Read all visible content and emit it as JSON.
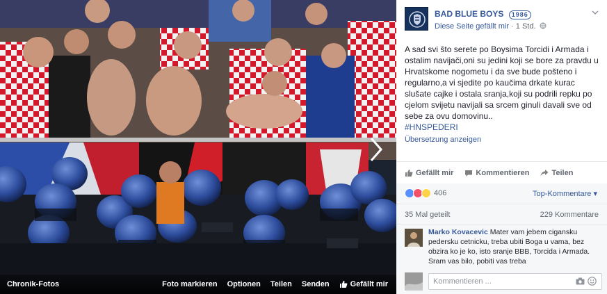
{
  "photo": {
    "album_label": "Chronik-Fotos",
    "actions": [
      "Foto markieren",
      "Optionen",
      "Teilen",
      "Senden"
    ],
    "like_label": "Gefällt mir"
  },
  "post": {
    "page_name": "BAD BLUE BOYS",
    "page_name_suffix": "1986",
    "likes_page": "Diese Seite gefällt mir",
    "meta_separator": " · ",
    "time": "1 Std.",
    "text": "A sad svi što serete po Boysima Torcidi i Armada i ostalim navijači,oni su jedini koji se bore za pravdu u Hrvatskome nogometu i da sve bude pošteno i regularno,a vi sjedite po kaučima drkate kurac slušate cajke i ostala sranja,koji su podrili repku po cjelom svijetu navijali sa srcem ginuli davali sve od sebe za ovu domovinu..",
    "hashtag": "#HNSPEDERI",
    "translate_label": "Übersetzung anzeigen"
  },
  "actions": {
    "like": "Gefällt mir",
    "comment": "Kommentieren",
    "share": "Teilen"
  },
  "stats": {
    "reactions_count": "406",
    "top_comments": "Top-Kommentare ▾",
    "shares": "35 Mal geteilt",
    "comments": "229 Kommentare"
  },
  "comment": {
    "author": "Marko Kovacevic",
    "text": " Mater vam jebem cigansku pedersku cetnicku, treba ubiti Boga u vama, bez obzira ko je ko, isto sranje BBB, Torcida i Armada. Sram vas bilo, pobiti vas treba"
  },
  "compose": {
    "placeholder": "Kommentieren ..."
  },
  "colors": {
    "link": "#365899",
    "meta": "#616770",
    "like_reaction": "#5890ff",
    "love_reaction": "#f25268",
    "haha_reaction": "#fcd348"
  }
}
